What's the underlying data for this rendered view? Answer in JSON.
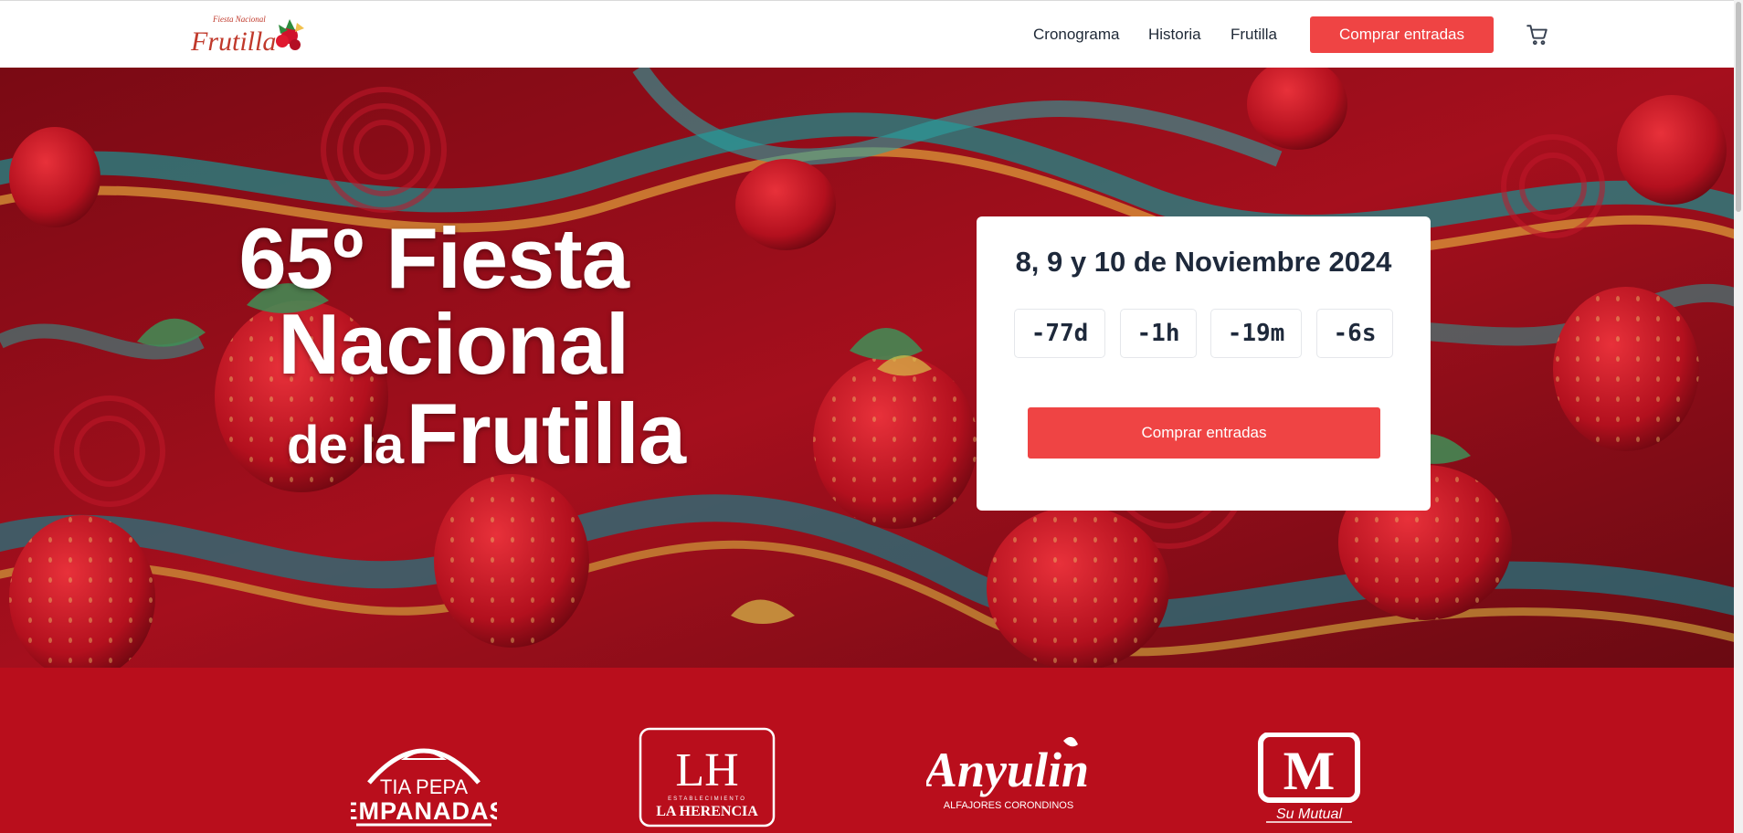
{
  "header": {
    "logo_text": "Fiesta Nacional de la Frutilla",
    "logo_top": "Fiesta Nacional",
    "logo_main": "Frutilla",
    "nav": [
      {
        "label": "Cronograma"
      },
      {
        "label": "Historia"
      },
      {
        "label": "Frutilla"
      }
    ],
    "buy_label": "Comprar entradas",
    "cart_icon": "shopping-cart-icon"
  },
  "hero": {
    "title_line1": "65º Fiesta",
    "title_line2": "Nacional",
    "title_line3_small": "de la",
    "title_line3_big": "Frutilla",
    "background": "strawberry-swirl-artwork"
  },
  "event_card": {
    "date": "8, 9 y 10 de Noviembre 2024",
    "countdown": {
      "days": "-77d",
      "hours": "-1h",
      "minutes": "-19m",
      "seconds": "-6s"
    },
    "buy_label": "Comprar entradas"
  },
  "sponsors": [
    {
      "name": "TIA PEPA",
      "sub": "EMPANADAS"
    },
    {
      "name": "LH",
      "sub": "LA HERENCIA",
      "tag": "ESTABLECIMIENTO"
    },
    {
      "name": "Anyulin",
      "sub": "ALFAJORES CORONDINOS"
    },
    {
      "name": "M",
      "sub": "Su Mutual"
    }
  ],
  "colors": {
    "accent": "#ef4444",
    "sponsor_band": "#b90e1c",
    "text_dark": "#1e293b"
  }
}
